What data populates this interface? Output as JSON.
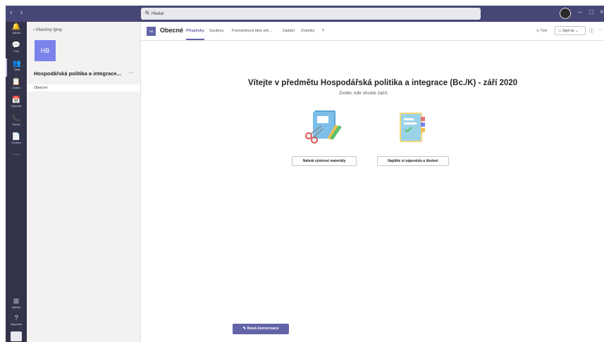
{
  "titlebar": {
    "nav": "‹  ›",
    "search_placeholder": "Hledat",
    "win_min": "–",
    "win_max": "□",
    "win_close": "×"
  },
  "rail": {
    "items": [
      {
        "label": "Aktivita",
        "icon": "bell-icon",
        "glyph": "🔔"
      },
      {
        "label": "Chat",
        "icon": "chat-icon",
        "glyph": "💬"
      },
      {
        "label": "Týmy",
        "icon": "teams-icon",
        "glyph": "👥"
      },
      {
        "label": "Zadání",
        "icon": "assignments-icon",
        "glyph": "📋"
      },
      {
        "label": "Kalendář",
        "icon": "calendar-icon",
        "glyph": "📅"
      },
      {
        "label": "Hovory",
        "icon": "phone-icon",
        "glyph": "📞"
      },
      {
        "label": "Soubory",
        "icon": "files-icon",
        "glyph": "📄"
      }
    ],
    "more": "···",
    "apps_label": "Aplikace",
    "help_label": "Nápověda"
  },
  "panel": {
    "back_label": "Všechny týmy",
    "team_initials": "HB",
    "team_name": "Hospodářská politika a integrace...",
    "team_more": "···",
    "channel": "Obecné"
  },
  "header": {
    "badge": "HB",
    "channel": "Obecné",
    "tabs": [
      "Příspěvky",
      "Soubory",
      "Poznámkový blok pře...",
      "Zadání",
      "Známky"
    ],
    "add_tab": "+",
    "team_label": "Tým",
    "meet_label": "Sejít se",
    "info": "ⓘ",
    "more": "···"
  },
  "welcome": {
    "title": "Vítejte v předmětu Hospodářská politika a integrace (Bc./K) - září 2020",
    "subtitle": "Zvolte, kde chcete začít.",
    "upload_button": "Nahrát výukové materiály",
    "help_button": "Najděte si nápovědu a školení"
  },
  "compose": {
    "new_conversation": "Nová konverzace"
  },
  "colors": {
    "brand": "#6264a7",
    "titlebar": "#464775",
    "rail": "#33344a"
  }
}
